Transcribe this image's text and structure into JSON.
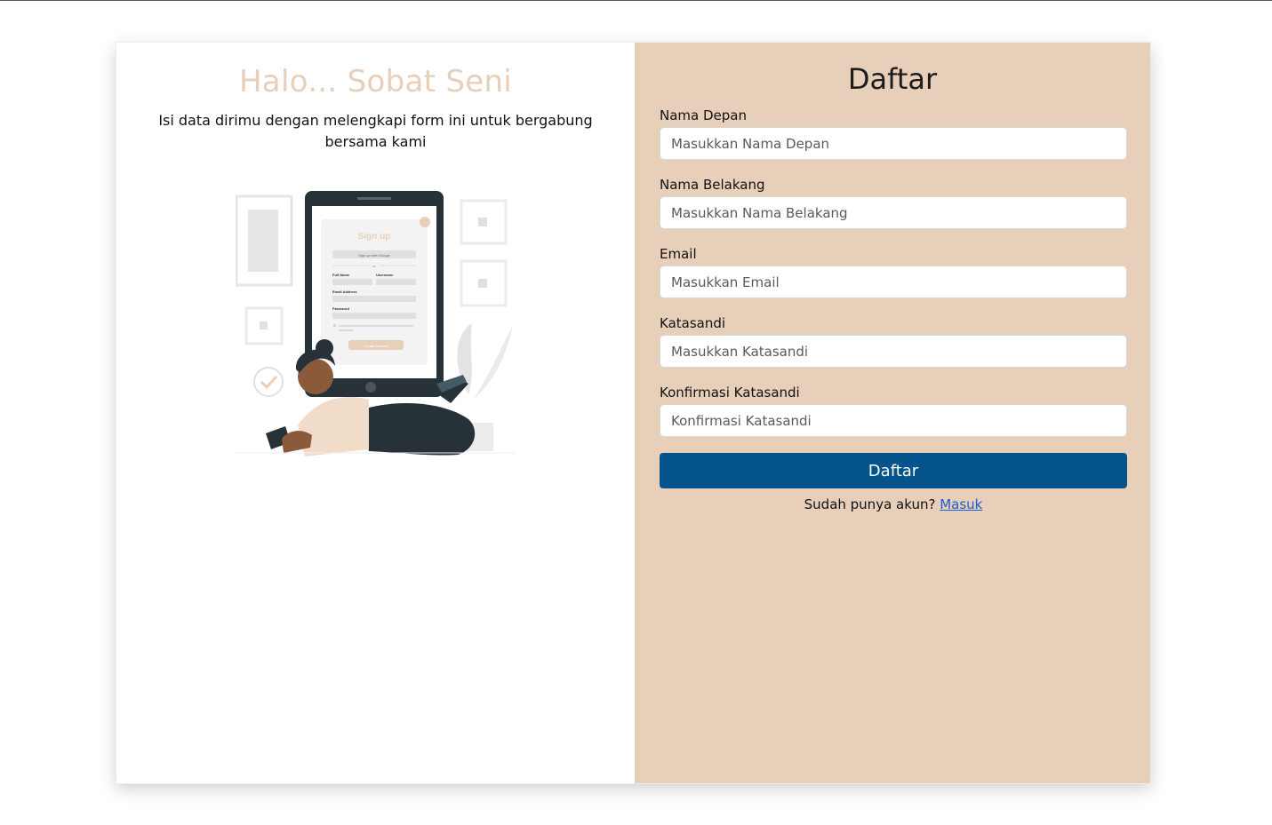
{
  "left_panel": {
    "heading": "Halo... Sobat Seni",
    "description": "Isi data dirimu dengan melengkapi form ini untuk bergabung bersama kami",
    "illustration": {
      "title": "Sign up",
      "google_button": "Sign up with Google",
      "divider": "or",
      "full_name_label": "Full Name",
      "username_label": "Username",
      "email_label": "Email Address",
      "password_label": "Password",
      "create_button": "Create Account"
    }
  },
  "form": {
    "title": "Daftar",
    "fields": {
      "first_name": {
        "label": "Nama Depan",
        "placeholder": "Masukkan Nama Depan"
      },
      "last_name": {
        "label": "Nama Belakang",
        "placeholder": "Masukkan Nama Belakang"
      },
      "email": {
        "label": "Email",
        "placeholder": "Masukkan Email"
      },
      "password": {
        "label": "Katasandi",
        "placeholder": "Masukkan Katasandi"
      },
      "confirm_password": {
        "label": "Konfirmasi Katasandi",
        "placeholder": "Konfirmasi Katasandi"
      }
    },
    "submit_label": "Daftar",
    "login_prompt": "Sudah punya akun?",
    "login_link": "Masuk"
  },
  "colors": {
    "accent_beige": "#e7cfb9",
    "button_blue": "#04538a",
    "link_blue": "#1a5fd6"
  }
}
